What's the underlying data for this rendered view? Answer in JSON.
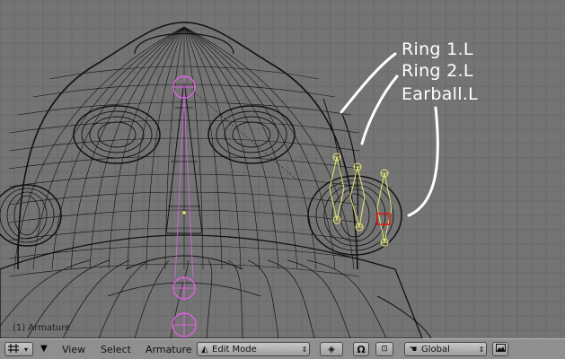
{
  "viewport": {
    "object_label": "(1) Armature",
    "annotations": {
      "ring1": "Ring 1.L",
      "ring2": "Ring 2.L",
      "earball": "Earball.L"
    },
    "colors": {
      "background": "#747474",
      "wire": "#111111",
      "bone_selected": "#e8e870",
      "bone_pink": "#e060e0",
      "annotation": "#ffffff",
      "active_red": "#e01010"
    }
  },
  "header": {
    "window_type_icon": "grid-icon",
    "menus": [
      "View",
      "Select",
      "Armature"
    ],
    "mode": "Edit Mode",
    "pivot_icon": "pivot-icon",
    "proportional_icon": "magnet-icon",
    "snap_icon": "snap-icon",
    "manipulator_icon": "hand-icon",
    "orientation": "Global",
    "render_icon": "image-icon"
  }
}
